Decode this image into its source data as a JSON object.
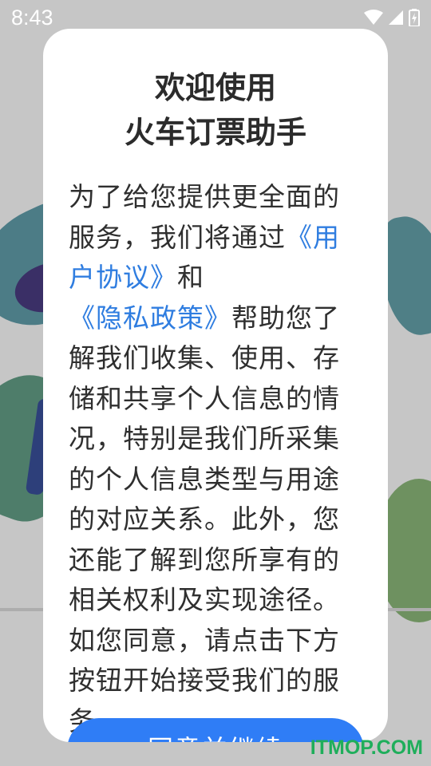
{
  "status_bar": {
    "time": "8:43",
    "icons": [
      "wifi-icon",
      "signal-icon",
      "battery-icon"
    ]
  },
  "dialog": {
    "title_line1": "欢迎使用",
    "title_line2": "火车订票助手",
    "body_part1": "为了给您提供更全面的服务，我们将通过",
    "user_agreement_link": "《用户协议》",
    "body_and": "和",
    "privacy_policy_link": "《隐私政策》",
    "body_part2": "帮助您了解我们收集、使用、存储和共享个人信息的情况，特别是我们所采集的个人信息类型与用途的对应关系。此外，您还能了解到您所享有的相关权利及实现途径。如您同意，请点击下方按钮开始接受我们的服务。",
    "agree_button": "同意并继续"
  },
  "watermark": "ITMOP.COM",
  "colors": {
    "link": "#2f7de0",
    "button": "#2f7df6",
    "watermark": "#1fae5b"
  }
}
